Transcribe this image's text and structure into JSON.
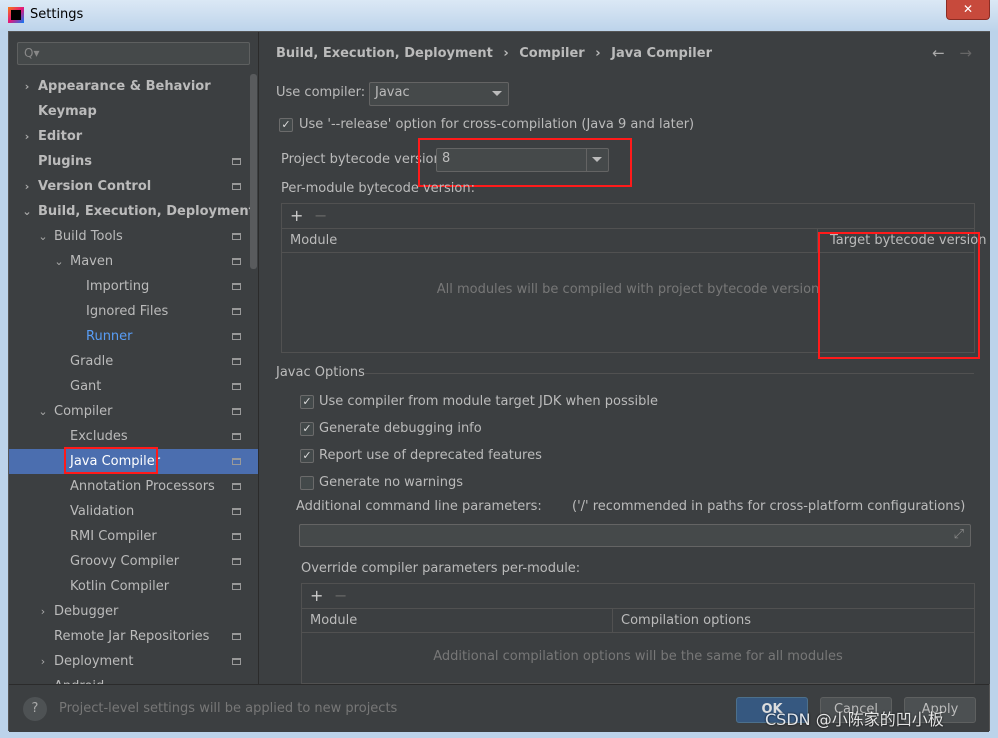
{
  "window": {
    "title": "Settings",
    "close": "✕"
  },
  "search": {
    "placeholder": "Q▾"
  },
  "sidebar": {
    "items": [
      {
        "label": "Appearance & Behavior",
        "level": 0,
        "arrow": "›",
        "bold": true
      },
      {
        "label": "Keymap",
        "level": 0,
        "bold": true
      },
      {
        "label": "Editor",
        "level": 0,
        "arrow": "›",
        "bold": true
      },
      {
        "label": "Plugins",
        "level": 0,
        "bold": true,
        "page": true
      },
      {
        "label": "Version Control",
        "level": 0,
        "arrow": "›",
        "bold": true,
        "page": true
      },
      {
        "label": "Build, Execution, Deployment",
        "level": 0,
        "arrow": "⌄",
        "bold": true
      },
      {
        "label": "Build Tools",
        "level": 1,
        "arrow": "⌄",
        "page": true
      },
      {
        "label": "Maven",
        "level": 2,
        "arrow": "⌄",
        "page": true
      },
      {
        "label": "Importing",
        "level": 3,
        "page": true
      },
      {
        "label": "Ignored Files",
        "level": 3,
        "page": true
      },
      {
        "label": "Runner",
        "level": 3,
        "page": true,
        "link": true
      },
      {
        "label": "Gradle",
        "level": 2,
        "page": true
      },
      {
        "label": "Gant",
        "level": 2,
        "page": true
      },
      {
        "label": "Compiler",
        "level": 1,
        "arrow": "⌄",
        "page": true
      },
      {
        "label": "Excludes",
        "level": 2,
        "page": true
      },
      {
        "label": "Java Compiler",
        "level": 2,
        "page": true,
        "selected": true
      },
      {
        "label": "Annotation Processors",
        "level": 2,
        "page": true
      },
      {
        "label": "Validation",
        "level": 2,
        "page": true
      },
      {
        "label": "RMI Compiler",
        "level": 2,
        "page": true
      },
      {
        "label": "Groovy Compiler",
        "level": 2,
        "page": true
      },
      {
        "label": "Kotlin Compiler",
        "level": 2,
        "page": true
      },
      {
        "label": "Debugger",
        "level": 1,
        "arrow": "›"
      },
      {
        "label": "Remote Jar Repositories",
        "level": 1,
        "page": true
      },
      {
        "label": "Deployment",
        "level": 1,
        "arrow": "›",
        "page": true
      },
      {
        "label": "Android",
        "level": 1,
        "arrow": "›"
      }
    ]
  },
  "breadcrumb": [
    "Build, Execution, Deployment",
    "›",
    "Compiler",
    "›",
    "Java Compiler"
  ],
  "nav": {
    "back": "←",
    "forward": "→"
  },
  "compiler": {
    "label": "Use compiler:",
    "value": "Javac"
  },
  "release_option": {
    "label": "Use '--release' option for cross-compilation (Java 9 and later)",
    "checked": true
  },
  "bytecode": {
    "label": "Project bytecode version:",
    "value": "8"
  },
  "per_module": {
    "label": "Per-module bytecode version:",
    "add": "+",
    "remove": "−",
    "col_module": "Module",
    "col_target": "Target bytecode version",
    "empty": "All modules will be compiled with project bytecode version"
  },
  "javac": {
    "title": "Javac Options",
    "options": [
      {
        "label": "Use compiler from module target JDK when possible",
        "checked": true
      },
      {
        "label": "Generate debugging info",
        "checked": true
      },
      {
        "label": "Report use of deprecated features",
        "checked": true
      },
      {
        "label": "Generate no warnings",
        "checked": false
      }
    ],
    "params_label": "Additional command line parameters:",
    "params_hint": "('/' recommended in paths for cross-platform configurations)",
    "params_value": "",
    "expand": "⤢"
  },
  "override": {
    "label": "Override compiler parameters per-module:",
    "add": "+",
    "remove": "−",
    "col_module": "Module",
    "col_options": "Compilation options",
    "empty": "Additional compilation options will be the same for all modules"
  },
  "footer": {
    "help": "?",
    "note": "Project-level settings will be applied to new projects",
    "ok": "OK",
    "cancel": "Cancel",
    "apply": "Apply"
  },
  "watermark": "CSDN @小陈家的凹小板"
}
